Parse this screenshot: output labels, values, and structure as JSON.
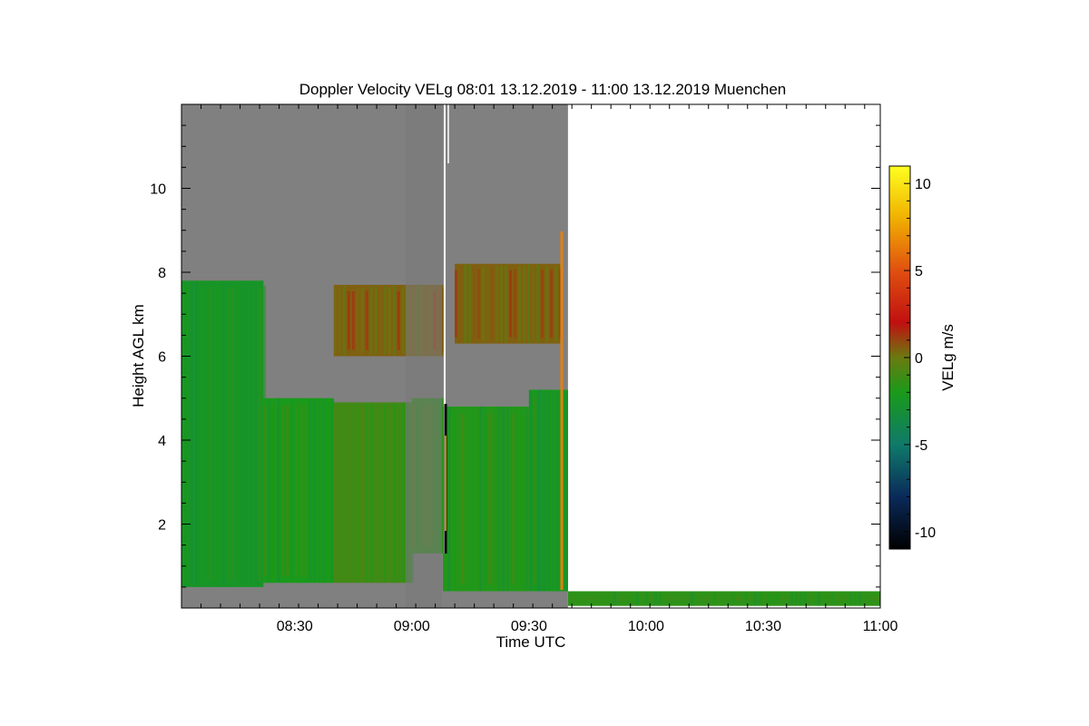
{
  "chart_data": {
    "type": "heatmap",
    "title": "Doppler Velocity VELg   08:01 13.12.2019 - 11:00 13.12.2019 Muenchen",
    "xlabel": "Time UTC",
    "ylabel": "Height AGL km",
    "xlim": [
      "08:01",
      "11:00"
    ],
    "ylim": [
      0,
      12
    ],
    "x_ticks": [
      "08:30",
      "09:00",
      "09:30",
      "10:00",
      "10:30",
      "11:00"
    ],
    "y_ticks": [
      2,
      4,
      6,
      8,
      10
    ],
    "colorbar": {
      "label": "VELg m/s",
      "range": [
        -11,
        11
      ],
      "ticks": [
        10,
        5,
        0,
        -5,
        -10
      ],
      "stops": [
        {
          "v": -11,
          "color": "#000000"
        },
        {
          "v": -8,
          "color": "#0a2a5a"
        },
        {
          "v": -5,
          "color": "#0f7a6a"
        },
        {
          "v": -2,
          "color": "#1a9a1a"
        },
        {
          "v": 0,
          "color": "#6a7a10"
        },
        {
          "v": 2,
          "color": "#c01010"
        },
        {
          "v": 5,
          "color": "#e05010"
        },
        {
          "v": 8,
          "color": "#f0b000"
        },
        {
          "v": 11,
          "color": "#ffff20"
        }
      ]
    },
    "background_color": "#808080",
    "data_end_time": "09:40",
    "regions": [
      {
        "t0": "08:01",
        "t1": "08:22",
        "h0": 0.5,
        "h1": 7.8,
        "velocity": -2.5
      },
      {
        "t0": "08:22",
        "t1": "08:40",
        "h0": 0.6,
        "h1": 5.0,
        "velocity": -2.0
      },
      {
        "t0": "08:40",
        "t1": "09:00",
        "h0": 0.6,
        "h1": 4.9,
        "velocity": -1.0
      },
      {
        "t0": "08:40",
        "t1": "09:08",
        "h0": 6.0,
        "h1": 7.7,
        "velocity": 0.5
      },
      {
        "t0": "09:00",
        "t1": "09:08",
        "h0": 1.3,
        "h1": 5.0,
        "velocity": -1.5
      },
      {
        "t0": "09:08",
        "t1": "09:30",
        "h0": 0.4,
        "h1": 4.8,
        "velocity": -1.8
      },
      {
        "t0": "09:11",
        "t1": "09:38",
        "h0": 6.3,
        "h1": 8.2,
        "velocity": 0.5
      },
      {
        "t0": "09:30",
        "t1": "09:40",
        "h0": 0.4,
        "h1": 5.2,
        "velocity": -2.2
      },
      {
        "t0": "09:40",
        "t1": "11:00",
        "h0": 0.05,
        "h1": 0.4,
        "velocity": -1.5
      }
    ]
  }
}
